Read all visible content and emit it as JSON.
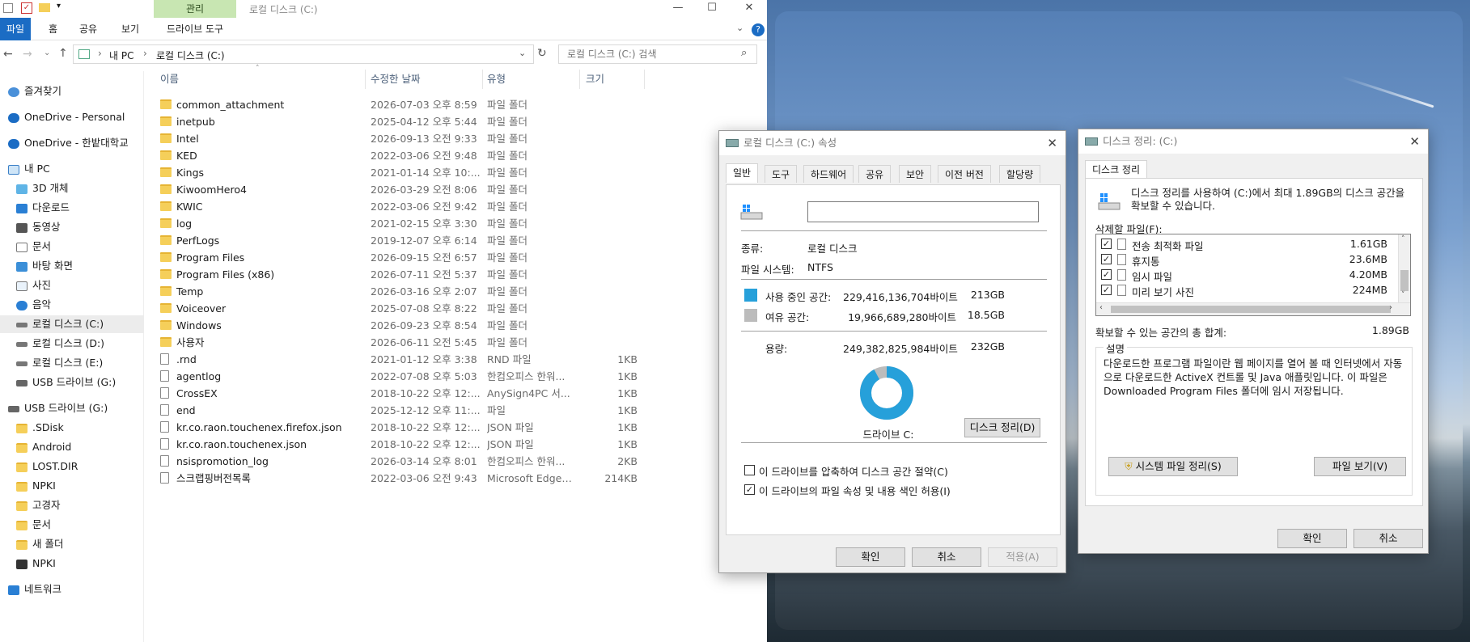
{
  "explorer": {
    "context_tab": "관리",
    "window_title": "로컬 디스크 (C:)",
    "ribbon_tabs": [
      "파일",
      "홈",
      "공유",
      "보기",
      "드라이브 도구"
    ],
    "breadcrumb": [
      "내 PC",
      "로컬 디스크 (C:)"
    ],
    "search_placeholder": "로컬 디스크 (C:) 검색",
    "columns": {
      "name": "이름",
      "date": "수정한 날짜",
      "type": "유형",
      "size": "크기"
    },
    "nav": [
      {
        "label": "즐겨찾기",
        "icon": "star-icon"
      },
      {
        "label": "OneDrive - Personal",
        "icon": "cloud-icon"
      },
      {
        "label": "OneDrive - 한밭대학교",
        "icon": "cloud-icon"
      },
      {
        "label": "내 PC",
        "icon": "pc-icon"
      },
      {
        "label": "3D 개체",
        "icon": "cube-icon"
      },
      {
        "label": "다운로드",
        "icon": "download-icon"
      },
      {
        "label": "동영상",
        "icon": "video-icon"
      },
      {
        "label": "문서",
        "icon": "document-icon"
      },
      {
        "label": "바탕 화면",
        "icon": "desktop-icon"
      },
      {
        "label": "사진",
        "icon": "picture-icon"
      },
      {
        "label": "음악",
        "icon": "music-icon"
      },
      {
        "label": "로컬 디스크 (C:)",
        "icon": "drive-icon"
      },
      {
        "label": "로컬 디스크 (D:)",
        "icon": "drive-icon"
      },
      {
        "label": "로컬 디스크 (E:)",
        "icon": "drive-icon"
      },
      {
        "label": "USB 드라이브 (G:)",
        "icon": "usb-icon"
      },
      {
        "label": "USB 드라이브 (G:)",
        "icon": "usb-icon"
      },
      {
        "label": ".SDisk",
        "icon": "folder-icon"
      },
      {
        "label": "Android",
        "icon": "folder-icon"
      },
      {
        "label": "LOST.DIR",
        "icon": "folder-icon"
      },
      {
        "label": "NPKI",
        "icon": "folder-icon"
      },
      {
        "label": "고경자",
        "icon": "folder-icon"
      },
      {
        "label": "문서",
        "icon": "folder-icon"
      },
      {
        "label": "새 폴더",
        "icon": "folder-icon"
      },
      {
        "label": "NPKI",
        "icon": "zip-icon"
      },
      {
        "label": "네트워크",
        "icon": "network-icon"
      }
    ],
    "files": [
      {
        "name": "common_attachment",
        "date": "2026-07-03 오후 8:59",
        "type": "파일 폴더",
        "size": "",
        "kind": "folder"
      },
      {
        "name": "inetpub",
        "date": "2025-04-12 오후 5:44",
        "type": "파일 폴더",
        "size": "",
        "kind": "folder"
      },
      {
        "name": "Intel",
        "date": "2026-09-13 오전 9:33",
        "type": "파일 폴더",
        "size": "",
        "kind": "folder"
      },
      {
        "name": "KED",
        "date": "2022-03-06 오전 9:48",
        "type": "파일 폴더",
        "size": "",
        "kind": "folder"
      },
      {
        "name": "Kings",
        "date": "2021-01-14 오후 10:...",
        "type": "파일 폴더",
        "size": "",
        "kind": "folder"
      },
      {
        "name": "KiwoomHero4",
        "date": "2026-03-29 오전 8:06",
        "type": "파일 폴더",
        "size": "",
        "kind": "folder"
      },
      {
        "name": "KWIC",
        "date": "2022-03-06 오전 9:42",
        "type": "파일 폴더",
        "size": "",
        "kind": "folder"
      },
      {
        "name": "log",
        "date": "2021-02-15 오후 3:30",
        "type": "파일 폴더",
        "size": "",
        "kind": "folder"
      },
      {
        "name": "PerfLogs",
        "date": "2019-12-07 오후 6:14",
        "type": "파일 폴더",
        "size": "",
        "kind": "folder"
      },
      {
        "name": "Program Files",
        "date": "2026-09-15 오전 6:57",
        "type": "파일 폴더",
        "size": "",
        "kind": "folder"
      },
      {
        "name": "Program Files (x86)",
        "date": "2026-07-11 오전 5:37",
        "type": "파일 폴더",
        "size": "",
        "kind": "folder"
      },
      {
        "name": "Temp",
        "date": "2026-03-16 오후 2:07",
        "type": "파일 폴더",
        "size": "",
        "kind": "folder"
      },
      {
        "name": "Voiceover",
        "date": "2025-07-08 오후 8:22",
        "type": "파일 폴더",
        "size": "",
        "kind": "folder"
      },
      {
        "name": "Windows",
        "date": "2026-09-23 오후 8:54",
        "type": "파일 폴더",
        "size": "",
        "kind": "folder"
      },
      {
        "name": "사용자",
        "date": "2026-06-11 오전 5:45",
        "type": "파일 폴더",
        "size": "",
        "kind": "folder"
      },
      {
        "name": ".rnd",
        "date": "2021-01-12 오후 3:38",
        "type": "RND 파일",
        "size": "1KB",
        "kind": "file"
      },
      {
        "name": "agentlog",
        "date": "2022-07-08 오후 5:03",
        "type": "한컴오피스 한워...",
        "size": "1KB",
        "kind": "file"
      },
      {
        "name": "CrossEX",
        "date": "2018-10-22 오후 12:...",
        "type": "AnySign4PC 서...",
        "size": "1KB",
        "kind": "file"
      },
      {
        "name": "end",
        "date": "2025-12-12 오후 11:...",
        "type": "파일",
        "size": "1KB",
        "kind": "file"
      },
      {
        "name": "kr.co.raon.touchenex.firefox.json",
        "date": "2018-10-22 오후 12:...",
        "type": "JSON 파일",
        "size": "1KB",
        "kind": "file"
      },
      {
        "name": "kr.co.raon.touchenex.json",
        "date": "2018-10-22 오후 12:...",
        "type": "JSON 파일",
        "size": "1KB",
        "kind": "file"
      },
      {
        "name": "nsispromotion_log",
        "date": "2026-03-14 오후 8:01",
        "type": "한컴오피스 한워...",
        "size": "2KB",
        "kind": "file"
      },
      {
        "name": "스크랩핑버전목록",
        "date": "2022-03-06 오전 9:43",
        "type": "Microsoft Edge ...",
        "size": "214KB",
        "kind": "file"
      }
    ]
  },
  "properties": {
    "title": "로컬 디스크 (C:) 속성",
    "tabs": [
      "일반",
      "도구",
      "하드웨어",
      "공유",
      "보안",
      "이전 버전",
      "할당량"
    ],
    "type_label": "종류:",
    "type_value": "로컬 디스크",
    "fs_label": "파일 시스템:",
    "fs_value": "NTFS",
    "used_label": "사용 중인 공간:",
    "used_bytes": "229,416,136,704바이트",
    "used_size": "213GB",
    "free_label": "여유 공간:",
    "free_bytes": "19,966,689,280바이트",
    "free_size": "18.5GB",
    "capacity_label": "용량:",
    "capacity_bytes": "249,382,825,984바이트",
    "capacity_size": "232GB",
    "used_fraction": 0.92,
    "drive_label": "드라이브 C:",
    "cleanup_button": "디스크 정리(D)",
    "compress_label": "이 드라이브를 압축하여 디스크 공간 절약(C)",
    "index_label": "이 드라이브의 파일 속성 및 내용 색인 허용(I)",
    "compress_checked": false,
    "index_checked": true,
    "ok": "확인",
    "cancel": "취소",
    "apply": "적용(A)",
    "colors": {
      "used": "#26a0da",
      "free": "#bcbcbc"
    }
  },
  "cleanup": {
    "title": "디스크 정리: (C:)",
    "tab": "디스크 정리",
    "intro": "디스크 정리를 사용하여 (C:)에서 최대 1.89GB의 디스크 공간을 확보할 수 있습니다.",
    "delete_label": "삭제할 파일(F):",
    "items": [
      {
        "name": "전송 최적화 파일",
        "size": "1.61GB",
        "checked": true
      },
      {
        "name": "휴지통",
        "size": "23.6MB",
        "checked": true
      },
      {
        "name": "임시 파일",
        "size": "4.20MB",
        "checked": true
      },
      {
        "name": "미리 보기 사진",
        "size": "224MB",
        "checked": true
      }
    ],
    "total_label": "확보할 수 있는 공간의 총 합계:",
    "total_value": "1.89GB",
    "desc_title": "설명",
    "desc_text": "다운로드한 프로그램 파일이란 웹 페이지를 열어 볼 때 인터넷에서 자동으로 다운로드한 ActiveX 컨트롤 및 Java 애플릿입니다. 이 파일은 Downloaded Program Files 폴더에 임시 저장됩니다.",
    "system_button": "시스템 파일 정리(S)",
    "view_button": "파일 보기(V)",
    "ok": "확인",
    "cancel": "취소"
  }
}
